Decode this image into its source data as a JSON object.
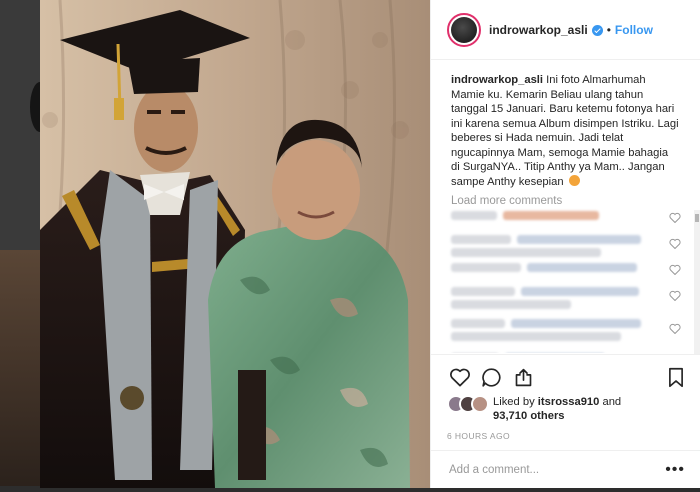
{
  "post": {
    "username": "indrowarkop_asli",
    "dot": "•",
    "follow_label": "Follow",
    "caption_user": "indrowarkop_asli",
    "caption_text": "Ini foto Almarhumah Mamie ku. Kemarin Beliau ulang tahun tanggal 15 Januari. Baru ketemu fotonya hari ini karena semua Album disimpen Istriku. Lagi beberes si Hada nemuin. Jadi telat ngucapinnya Mam, semoga Mamie bahagia di SurgaNYA.. Titip Anthy ya Mam.. Jangan sampe Anthy kesepian",
    "load_more": "Load more comments",
    "liked_by_prefix": "Liked by",
    "liked_by_user": "itsrossa910",
    "liked_by_and": "and",
    "likes_count": "93,710 others",
    "timestamp": "6 HOURS AGO",
    "comment_placeholder": "Add a comment...",
    "more_label": "•••"
  },
  "colors": {
    "link": "#3897f0",
    "story_ring": "#e0306b",
    "text": "#262626",
    "muted": "#999999"
  },
  "icons": [
    "verified-badge-icon",
    "heart-icon",
    "comment-icon",
    "share-icon",
    "bookmark-icon",
    "more-options-icon"
  ]
}
